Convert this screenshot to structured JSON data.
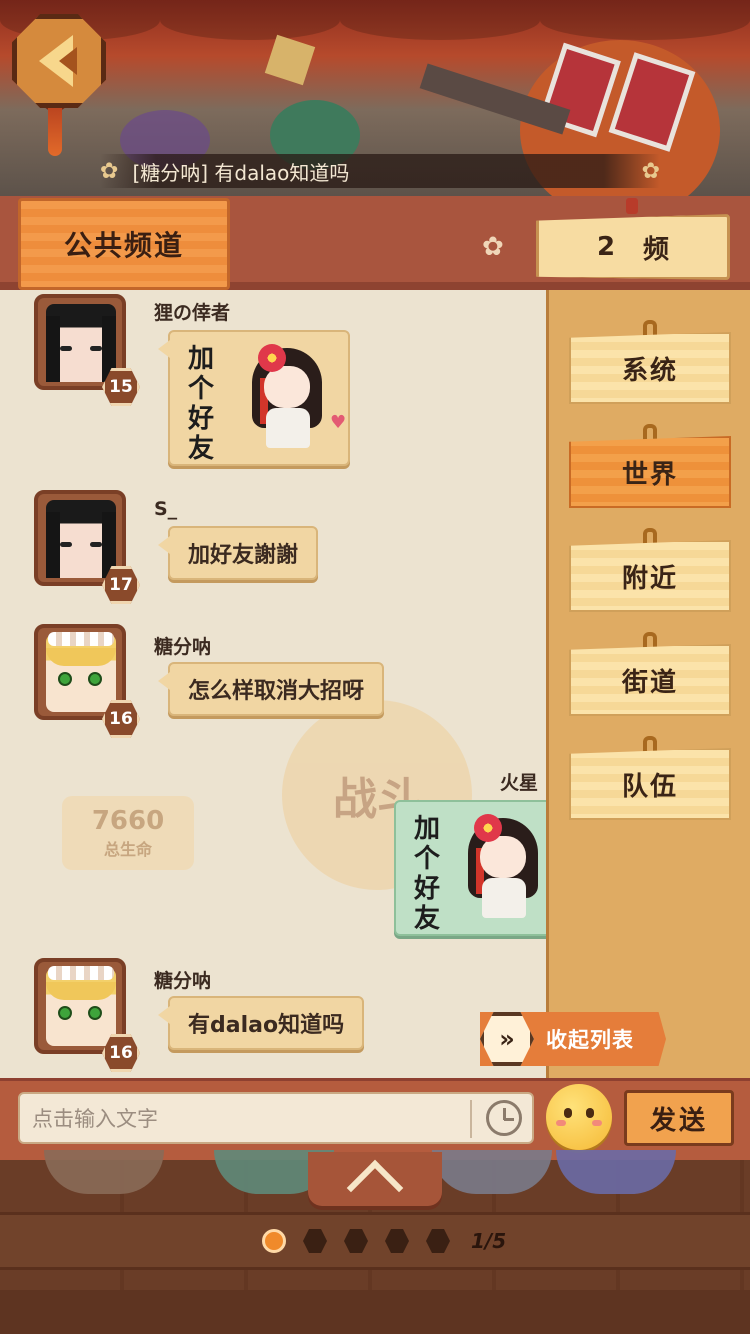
{
  "ticker": {
    "text": "[糖分呐] 有dalao知道吗"
  },
  "header": {
    "channel_title": "公共频道",
    "channel_number": "2",
    "channel_suffix": "频"
  },
  "sidebar": {
    "tabs": [
      {
        "label": "系统",
        "active": false
      },
      {
        "label": "世界",
        "active": true
      },
      {
        "label": "附近",
        "active": false
      },
      {
        "label": "街道",
        "active": false
      },
      {
        "label": "队伍",
        "active": false
      }
    ],
    "collapse_label": "收起列表"
  },
  "watermark": {
    "battle": "战斗",
    "hp_value": "7660",
    "hp_label": "总生命"
  },
  "messages": [
    {
      "user": "狸の倖者",
      "level": "15",
      "type": "sticker",
      "sticker_text": "加个好友"
    },
    {
      "user": "S_",
      "level": "17",
      "type": "text",
      "text": "加好友謝謝"
    },
    {
      "user": "糖分呐",
      "level": "16",
      "type": "text",
      "text": "怎么样取消大招呀"
    },
    {
      "user": "火星",
      "type": "sticker",
      "self": true,
      "sticker_text": "加个好友"
    },
    {
      "user": "糖分呐",
      "level": "16",
      "type": "text",
      "text": "有dalao知道吗"
    }
  ],
  "input": {
    "placeholder": "点击输入文字",
    "send_label": "发送"
  },
  "pager": {
    "current": 1,
    "total": 5,
    "label": "1/5"
  },
  "colors": {
    "accent": "#f08a2a",
    "panel": "#ece3d0",
    "sidebar": "#dfab63",
    "self_bubble": "#bfe0c6"
  }
}
